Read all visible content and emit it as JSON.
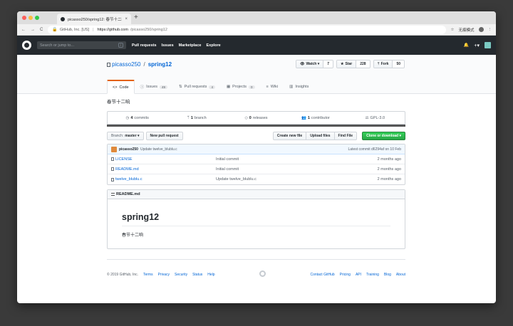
{
  "browser": {
    "tab_title": "picasso250/spring12: 春节十二响",
    "tab_close": "×",
    "new_tab": "+",
    "back": "←",
    "forward": "→",
    "reload": "C",
    "site_identity": "GitHub, Inc. [US]",
    "url_domain": "https://github.com",
    "url_path": "/picasso250/spring12",
    "star": "☆",
    "incognito": "无痕模式",
    "menu": "⋮"
  },
  "header": {
    "search_placeholder": "Search or jump to...",
    "search_key": "/",
    "nav": [
      "Pull requests",
      "Issues",
      "Marketplace",
      "Explore"
    ],
    "bell": "🔔",
    "plus": "+▾"
  },
  "repo": {
    "owner": "picasso250",
    "separator": "/",
    "name": "spring12",
    "watch_label": "Watch ▾",
    "watch_count": "7",
    "star_label": "Star",
    "star_count": "228",
    "fork_label": "Fork",
    "fork_count": "50",
    "tabs": [
      {
        "label": "Code",
        "icon": "<>",
        "count": ""
      },
      {
        "label": "Issues",
        "icon": "ⓘ",
        "count": "49"
      },
      {
        "label": "Pull requests",
        "icon": "⇅",
        "count": "4"
      },
      {
        "label": "Projects",
        "icon": "▦",
        "count": "0"
      },
      {
        "label": "Wiki",
        "icon": "≡",
        "count": ""
      },
      {
        "label": "Insights",
        "icon": "▥",
        "count": ""
      }
    ]
  },
  "main": {
    "description": "春节十二响",
    "summary": [
      {
        "icon": "◷",
        "num": "4",
        "label": "commits"
      },
      {
        "icon": "ᛘ",
        "num": "1",
        "label": "branch"
      },
      {
        "icon": "◇",
        "num": "0",
        "label": "releases"
      },
      {
        "icon": "👥",
        "num": "1",
        "label": "contributor"
      },
      {
        "icon": "⚖",
        "num": "",
        "label": "GPL-3.0"
      }
    ],
    "branch_label": "Branch:",
    "branch_value": "master ▾",
    "new_pull_request": "New pull request",
    "create_new_file": "Create new file",
    "upload_files": "Upload files",
    "find_file": "Find File",
    "clone": "Clone or download ▾",
    "commit": {
      "author": "picasso250",
      "message": "Update twelve_blublu.c",
      "latest": "Latest commit d6294af on 10 Feb"
    },
    "files": [
      {
        "name": "LICENSE",
        "message": "Initial commit",
        "age": "2 months ago"
      },
      {
        "name": "README.md",
        "message": "Initial commit",
        "age": "2 months ago"
      },
      {
        "name": "twelve_blublu.c",
        "message": "Update twelve_blublu.c",
        "age": "2 months ago"
      }
    ],
    "readme_title": "README.md",
    "readme_h1": "spring12",
    "readme_text": "春节十二响"
  },
  "footer": {
    "copyright": "© 2019 GitHub, Inc.",
    "left_links": [
      "Terms",
      "Privacy",
      "Security",
      "Status",
      "Help"
    ],
    "right_links": [
      "Contact GitHub",
      "Pricing",
      "API",
      "Training",
      "Blog",
      "About"
    ]
  },
  "colors": {
    "header_bg": "#24292e",
    "link": "#0366d6",
    "active_tab_accent": "#e36209",
    "clone_green": "#28a745",
    "language_bar": "#555555"
  }
}
